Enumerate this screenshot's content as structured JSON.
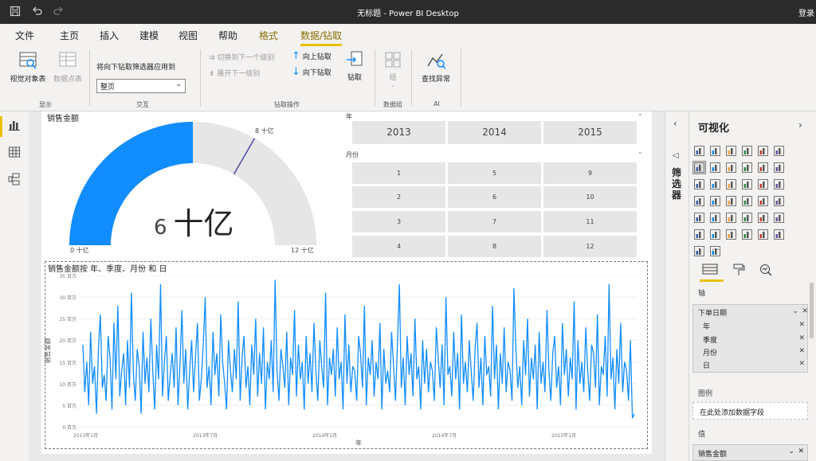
{
  "window": {
    "title": "无标题 - Power BI Desktop",
    "signin": "登录",
    "quick_access": {
      "save_icon": "save-icon",
      "undo_icon": "undo-icon",
      "redo_icon": "redo-icon"
    }
  },
  "ribbon": {
    "tabs": [
      {
        "label": "文件"
      },
      {
        "label": "主页"
      },
      {
        "label": "插入"
      },
      {
        "label": "建模"
      },
      {
        "label": "视图"
      },
      {
        "label": "帮助"
      },
      {
        "label": "格式"
      },
      {
        "label": "数据/钻取"
      }
    ],
    "active_tab": "数据/钻取",
    "groups": {
      "show": {
        "label": "显示",
        "visual_table": "视觉对象表",
        "data_point_table": "数据点表"
      },
      "interaction": {
        "label": "交互",
        "apply_drill_label": "将向下钻取筛选器应用到",
        "apply_drill_value": "整页"
      },
      "drill": {
        "label": "钻取操作",
        "switch_next_level": "切换到下一个级别",
        "expand_next_level": "展开下一级别",
        "drill_up": "向上钻取",
        "drill_down": "向下钻取",
        "drill_through": "钻取"
      },
      "data_group": {
        "label": "数据组",
        "group": "组"
      },
      "ai": {
        "label": "AI",
        "find_anomalies": "查找异常"
      }
    }
  },
  "left_nav": {
    "items": [
      {
        "name": "report-view-icon",
        "active": true
      },
      {
        "name": "data-view-icon",
        "active": false
      },
      {
        "name": "model-view-icon",
        "active": false
      }
    ]
  },
  "gauge": {
    "title": "销售金额",
    "value": 6,
    "max": 12,
    "target": 8,
    "value_number": "6",
    "value_unit": "十亿",
    "min_label": "0 十亿",
    "max_label": "12 十亿",
    "target_label": "8 十亿",
    "fill_color": "#118dff",
    "track_color": "#e6e6e6",
    "target_color": "#4b4ba0"
  },
  "slicers": {
    "year": {
      "header": "年",
      "items": [
        "2013",
        "2014",
        "2015"
      ]
    },
    "month": {
      "header": "月份",
      "items": [
        "1",
        "5",
        "9",
        "2",
        "6",
        "10",
        "3",
        "7",
        "11",
        "4",
        "8",
        "12"
      ]
    }
  },
  "chart_data": {
    "type": "line",
    "title": "销售金额按 年、季度、月份 和 日",
    "xlabel": "年",
    "ylabel": "销售金额",
    "ylim": [
      0,
      35
    ],
    "y_unit": "百万",
    "yticks": [
      "35 百万",
      "30 百万",
      "25 百万",
      "20 百万",
      "15 百万",
      "10 百万",
      "5 百万",
      "0 百万"
    ],
    "xticks": [
      "2013年1月",
      "2013年7月",
      "2014年1月",
      "2014年7月",
      "2015年1月"
    ],
    "series": [
      {
        "color": "#118dff",
        "values": [
          19,
          8,
          15,
          5,
          22,
          10,
          14,
          3,
          18,
          26,
          9,
          12,
          6,
          21,
          16,
          4,
          24,
          11,
          28,
          7,
          13,
          17,
          5,
          20,
          9,
          31,
          12,
          6,
          18,
          14,
          3,
          22,
          10,
          16,
          8,
          25,
          13,
          4,
          19,
          11,
          33,
          7,
          15,
          21,
          6,
          12,
          17,
          9,
          23,
          5,
          14,
          27,
          10,
          18,
          4,
          13,
          20,
          8,
          16,
          24,
          6,
          11,
          19,
          30,
          9,
          14,
          5,
          22,
          12,
          17,
          7,
          26,
          15,
          10,
          4,
          20,
          13,
          8,
          18,
          11,
          29,
          6,
          16,
          21,
          9,
          14,
          5,
          19,
          12,
          25,
          7,
          17,
          10,
          23,
          4,
          15,
          11,
          20,
          8,
          34,
          13,
          6,
          18,
          14,
          9,
          22,
          5,
          16,
          12,
          27,
          7,
          19,
          11,
          15,
          4,
          21,
          10,
          17,
          8,
          24,
          13,
          6,
          20,
          14,
          9,
          31,
          5,
          16,
          12,
          18,
          7,
          23,
          11,
          15,
          4,
          26,
          10,
          19,
          8,
          14,
          13,
          6,
          21,
          17,
          9,
          28,
          5,
          16,
          12,
          20,
          7,
          15,
          11,
          24,
          4,
          18,
          10,
          13,
          8,
          22,
          14,
          6,
          19,
          33,
          9,
          16,
          5,
          21,
          12,
          17,
          7,
          25,
          11,
          14,
          4,
          20,
          10,
          18,
          8,
          15,
          13,
          6,
          23,
          16,
          9,
          19,
          5,
          30,
          12,
          14,
          7,
          22,
          11,
          17,
          4,
          26,
          10,
          15,
          8,
          20,
          13,
          6,
          18,
          24,
          9,
          16,
          5,
          21,
          12,
          14,
          7,
          28,
          11,
          19,
          4,
          17,
          10,
          23,
          8,
          15,
          13,
          6,
          32,
          18,
          9,
          14,
          5,
          20,
          12,
          25,
          7,
          16,
          11,
          19,
          4,
          22,
          10,
          15,
          8,
          27,
          13,
          6,
          17,
          21,
          9,
          14,
          5,
          24,
          12,
          18,
          7,
          16,
          11,
          29,
          4,
          20,
          10,
          15,
          8,
          23,
          13,
          6,
          19,
          17,
          9,
          26,
          5,
          14,
          12,
          21,
          7,
          33,
          11,
          16,
          4,
          18,
          10,
          24,
          8,
          15,
          13,
          6,
          20,
          2,
          3
        ]
      }
    ]
  },
  "filters_pane": {
    "label": "筛选器"
  },
  "viz_pane": {
    "title": "可视化",
    "axis_label": "轴",
    "axis_field": "下单日期",
    "axis_children": [
      "年",
      "季度",
      "月份",
      "日"
    ],
    "legend_label": "图例",
    "legend_placeholder": "在此处添加数据字段",
    "values_label": "值",
    "values_field": "销售金额",
    "icons": [
      "stacked-bar-icon",
      "stacked-column-icon",
      "clustered-bar-icon",
      "clustered-column-icon",
      "100-bar-icon",
      "100-column-icon",
      "line-chart-icon",
      "area-chart-icon",
      "stacked-area-icon",
      "line-column-icon",
      "line-clustered-icon",
      "ribbon-chart-icon",
      "waterfall-icon",
      "funnel-icon",
      "scatter-icon",
      "pie-chart-icon",
      "donut-chart-icon",
      "treemap-icon",
      "map-icon",
      "filled-map-icon",
      "gauge-icon",
      "card-icon",
      "multi-row-card-icon",
      "kpi-icon",
      "slicer-icon",
      "table-icon",
      "matrix-icon",
      "r-visual-icon",
      "python-visual-icon",
      "key-influencers-icon",
      "decomposition-tree-icon",
      "qa-icon",
      "paginated-report-icon",
      "smart-narrative-icon",
      "arcgis-icon",
      "powerapps-icon",
      "power-automate-icon",
      "more-visuals-icon"
    ],
    "more_label": "···"
  }
}
